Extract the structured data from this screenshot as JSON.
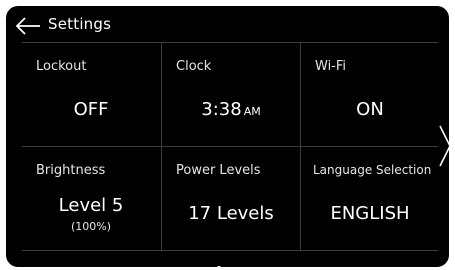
{
  "header": {
    "title": "Settings",
    "back_icon": "arrow-left-icon"
  },
  "tiles": [
    {
      "label": "Lockout",
      "value": "OFF"
    },
    {
      "label": "Clock",
      "value": "3:38",
      "suffix": "AM"
    },
    {
      "label": "Wi-Fi",
      "value": "ON"
    },
    {
      "label": "Brightness",
      "value": "Level 5",
      "sub": "(100%)"
    },
    {
      "label": "Power Levels",
      "value": "17 Levels"
    },
    {
      "label": "Language Selection",
      "value": "ENGLISH"
    }
  ],
  "navigation": {
    "next_icon": "chevron-right-icon",
    "page_count": 2,
    "current_page": 1
  },
  "colors": {
    "background": "#000000",
    "text": "#ffffff",
    "divider": "#3c3c3c"
  }
}
